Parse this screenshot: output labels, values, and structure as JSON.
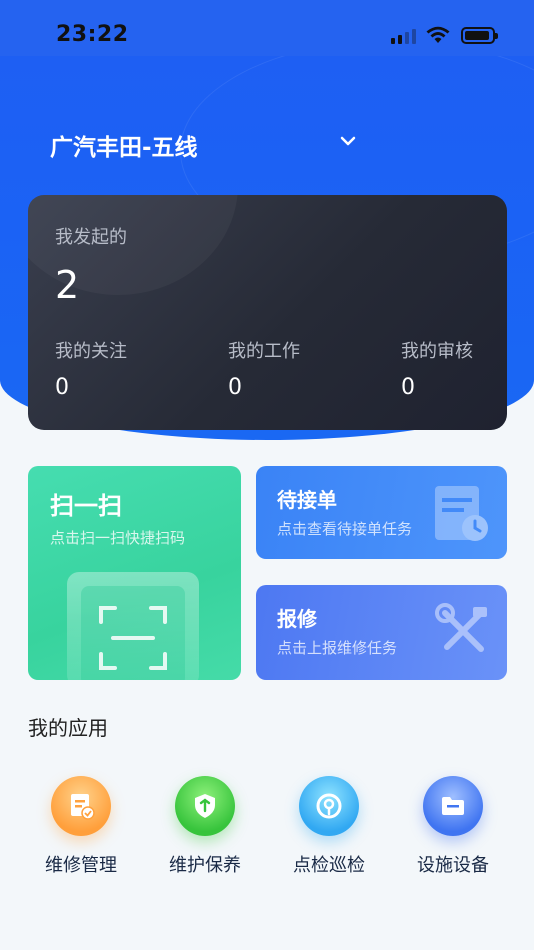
{
  "status_bar": {
    "time": "23:22",
    "icons": [
      "signal-icon",
      "wifi-icon",
      "battery-icon"
    ]
  },
  "header": {
    "plant_name": "广汽丰田-五线",
    "dropdown_icon": "chevron-down-icon",
    "background_color": "#1f5ef2"
  },
  "stats": {
    "initiated_label": "我发起的",
    "initiated_value": "2",
    "follow_label": "我的关注",
    "follow_value": "0",
    "work_label": "我的工作",
    "work_value": "0",
    "review_label": "我的审核",
    "review_value": "0"
  },
  "quick_actions": {
    "scan": {
      "title": "扫一扫",
      "subtitle": "点击扫一扫快捷扫码",
      "icon": "scan-icon",
      "color": "#3ed5a2"
    },
    "pending": {
      "title": "待接单",
      "subtitle": "点击查看待接单任务",
      "icon": "pending-order-icon",
      "color": "#3f88f7"
    },
    "repair": {
      "title": "报修",
      "subtitle": "点击上报维修任务",
      "icon": "tools-icon",
      "color": "#5a82f4"
    }
  },
  "apps": {
    "section_title": "我的应用",
    "items": [
      {
        "label": "维修管理",
        "icon": "maintenance-doc-icon",
        "color": "#ffa23f"
      },
      {
        "label": "维护保养",
        "icon": "care-wrench-icon",
        "color": "#3cc53f"
      },
      {
        "label": "点检巡检",
        "icon": "inspection-icon",
        "color": "#33aaf2"
      },
      {
        "label": "设施设备",
        "icon": "equipment-folder-icon",
        "color": "#4176f1"
      }
    ]
  }
}
